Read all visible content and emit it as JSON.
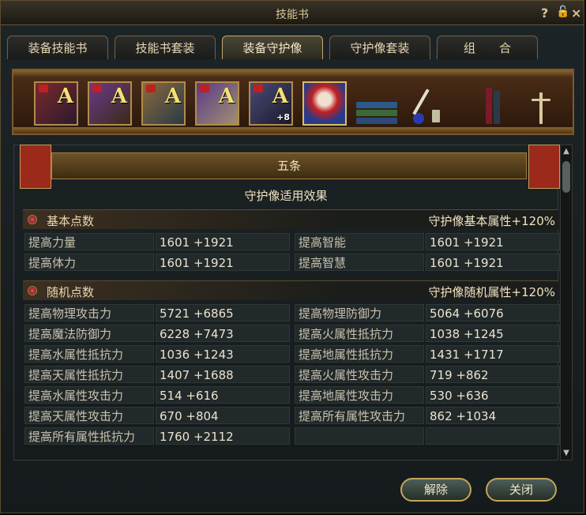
{
  "window": {
    "title": "技能书",
    "help": "?",
    "lock": "🔓",
    "close": "×"
  },
  "tabs": [
    "装备技能书",
    "技能书套装",
    "装备守护像",
    "守护像套装",
    "组　　合"
  ],
  "slots": [
    {
      "mark": "A",
      "plus": ""
    },
    {
      "mark": "A",
      "plus": ""
    },
    {
      "mark": "A",
      "plus": ""
    },
    {
      "mark": "A",
      "plus": ""
    },
    {
      "mark": "A",
      "plus": "+8"
    },
    {
      "mark": "",
      "plus": ""
    }
  ],
  "banner": "五条",
  "subhead": "守护像适用效果",
  "base": {
    "title": "基本点数",
    "bonus": "守护像基本属性+120%",
    "rows": [
      [
        "提高力量",
        "1601 +1921",
        "提高智能",
        "1601 +1921"
      ],
      [
        "提高体力",
        "1601 +1921",
        "提高智慧",
        "1601 +1921"
      ]
    ]
  },
  "random": {
    "title": "随机点数",
    "bonus": "守护像随机属性+120%",
    "rows": [
      [
        "提高物理攻击力",
        "5721 +6865",
        "提高物理防御力",
        "5064 +6076"
      ],
      [
        "提高魔法防御力",
        "6228 +7473",
        "提高火属性抵抗力",
        "1038 +1245"
      ],
      [
        "提高水属性抵抗力",
        "1036 +1243",
        "提高地属性抵抗力",
        "1431 +1717"
      ],
      [
        "提高天属性抵抗力",
        "1407 +1688",
        "提高火属性攻击力",
        "719 +862"
      ],
      [
        "提高水属性攻击力",
        "514 +616",
        "提高地属性攻击力",
        "530 +636"
      ],
      [
        "提高天属性攻击力",
        "670 +804",
        "提高所有属性攻击力",
        "862 +1034"
      ],
      [
        "提高所有属性抵抗力",
        "1760 +2112",
        "",
        ""
      ]
    ]
  },
  "buttons": {
    "remove": "解除",
    "close": "关闭"
  }
}
